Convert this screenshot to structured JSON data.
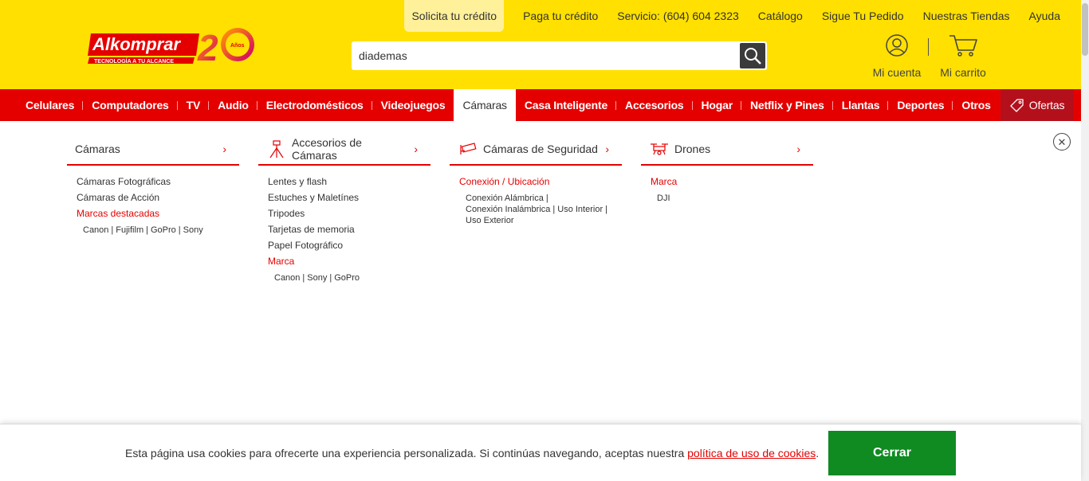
{
  "brand": {
    "logo_text": "Alkomprar",
    "tagline": "TECNOLOGÍA A TU ALCANCE",
    "anniversary": "20",
    "anniversary_label": "Años",
    "primary_color": "#ffe000",
    "accent_color": "#e50000"
  },
  "top_links": [
    {
      "label": "Solicita tu crédito"
    },
    {
      "label": "Paga tu crédito"
    },
    {
      "label": "Servicio: (604) 604 2323"
    },
    {
      "label": "Catálogo"
    },
    {
      "label": "Sigue Tu Pedido"
    },
    {
      "label": "Nuestras Tiendas"
    },
    {
      "label": "Ayuda"
    }
  ],
  "search": {
    "value": "diademas",
    "icon": "search-icon"
  },
  "account": {
    "label": "Mi cuenta",
    "icon": "user-icon"
  },
  "cart": {
    "label": "Mi carrito",
    "icon": "cart-icon"
  },
  "nav": {
    "items": [
      {
        "label": "Celulares"
      },
      {
        "label": "Computadores"
      },
      {
        "label": "TV"
      },
      {
        "label": "Audio"
      },
      {
        "label": "Electrodomésticos"
      },
      {
        "label": "Videojuegos"
      },
      {
        "label": "Cámaras"
      },
      {
        "label": "Casa Inteligente"
      },
      {
        "label": "Accesorios"
      },
      {
        "label": "Hogar"
      },
      {
        "label": "Netflix y Pines"
      },
      {
        "label": "Llantas"
      },
      {
        "label": "Deportes"
      },
      {
        "label": "Otros"
      }
    ],
    "active": "Cámaras",
    "offers": {
      "label": "Ofertas",
      "icon": "tag-icon"
    }
  },
  "mega_menu": {
    "columns": [
      {
        "title": "Cámaras",
        "links": [
          {
            "label": "Cámaras Fotográficas"
          },
          {
            "label": "Cámaras de Acción"
          }
        ],
        "brand_heading": "Marcas destacadas",
        "brands": [
          "Canon",
          "Fujifilm",
          "GoPro",
          "Sony"
        ]
      },
      {
        "title": "Accesorios de Cámaras",
        "icon": "tripod-icon",
        "links": [
          {
            "label": "Lentes y flash"
          },
          {
            "label": "Estuches y Maletínes"
          },
          {
            "label": "Tripodes"
          },
          {
            "label": "Tarjetas de memoria"
          },
          {
            "label": "Papel Fotográfico"
          }
        ],
        "brand_heading": "Marca",
        "brands": [
          "Canon",
          "Sony",
          "GoPro"
        ]
      },
      {
        "title": "Cámaras de Seguridad",
        "icon": "security-camera-icon",
        "links": [],
        "brand_heading": "Conexión / Ubicación",
        "brands": [
          "Conexión Alámbrica",
          "Conexión Inalámbrica",
          "Uso Interior",
          "Uso Exterior"
        ]
      },
      {
        "title": "Drones",
        "icon": "drone-icon",
        "links": [],
        "brand_heading": "Marca",
        "brands": [
          "DJI"
        ]
      }
    ],
    "close_icon": "close-icon"
  },
  "cookie_bar": {
    "text": "Esta página usa cookies para ofrecerte una experiencia personalizada. Si continúas navegando, aceptas nuestra ",
    "link_text": "política de uso de cookies",
    "suffix": ".",
    "button": "Cerrar",
    "button_color": "#0f8b22"
  }
}
